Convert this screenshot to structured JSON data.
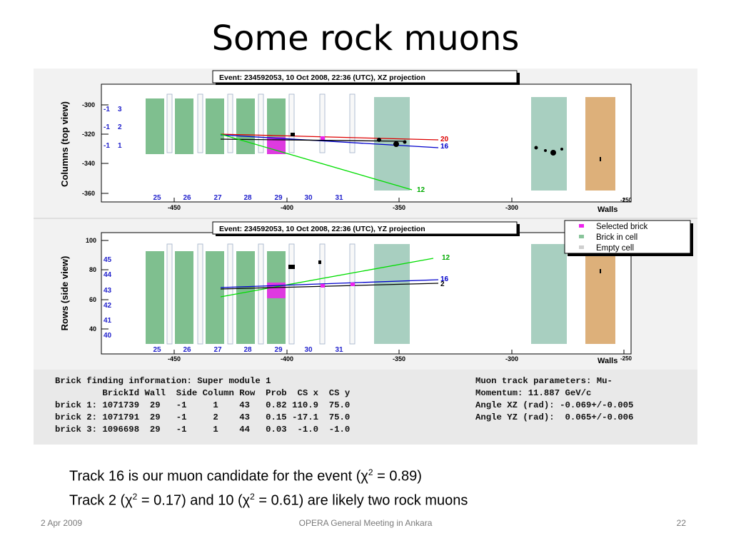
{
  "slide": {
    "title": "Some rock muons",
    "footer_left": "2 Apr 2009",
    "footer_center": "OPERA General Meeting in Ankara",
    "footer_right": "22"
  },
  "plot_top": {
    "header": "Event: 234592053, 10 Oct 2008, 22:36 (UTC), XZ projection",
    "ylabel": "Columns (top view)",
    "xlabel": "Walls",
    "x_ticks": [
      "-450",
      "-400",
      "-350",
      "-300",
      "-250"
    ],
    "y_ticks": [
      "-300",
      "-320",
      "-340",
      "-360"
    ],
    "walls": [
      "25",
      "26",
      "27",
      "28",
      "29",
      "30",
      "31"
    ],
    "left_labels": [
      [
        "-1",
        "3"
      ],
      [
        "-1",
        "2"
      ],
      [
        "-1",
        "1"
      ]
    ],
    "track_labels": [
      "20",
      "16",
      "12"
    ]
  },
  "plot_bottom": {
    "header": "Event: 234592053, 10 Oct 2008, 22:36 (UTC), YZ projection",
    "ylabel": "Rows (side view)",
    "xlabel": "Walls",
    "x_ticks": [
      "-450",
      "-400",
      "-350",
      "-300",
      "-250"
    ],
    "y_ticks": [
      "100",
      "80",
      "60",
      "40"
    ],
    "walls": [
      "25",
      "26",
      "27",
      "28",
      "29",
      "30",
      "31"
    ],
    "left_labels": [
      "45",
      "44",
      "43",
      "42",
      "41",
      "40"
    ],
    "track_labels": [
      "12",
      "16",
      "2"
    ],
    "legend": [
      {
        "label": "Selected brick",
        "color": "#ee22ee"
      },
      {
        "label": "Brick in cell",
        "color": "#88c49a"
      },
      {
        "label": "Empty cell",
        "color": "#cfcfcf"
      }
    ]
  },
  "colors": {
    "brick_green": "#7fbf8f",
    "tt_green": "#a8cfc0",
    "magnet_tan": "#ddb07a",
    "selected_magenta": "#ee22ee",
    "track_red": "#dd0000",
    "track_blue": "#0000cc",
    "track_green": "#00dd00",
    "track_black": "#000000"
  },
  "info_text": {
    "left": [
      "Brick finding information: Super module 1",
      "         BrickId Wall  Side Column Row  Prob  CS x  CS y",
      "brick 1: 1071739  29   -1     1    43   0.82 110.9  75.0",
      "brick 2: 1071791  29   -1     2    43   0.15 -17.1  75.0",
      "brick 3: 1096698  29   -1     1    44   0.03  -1.0  -1.0"
    ],
    "right": [
      "Muon track parameters: Mu-",
      "Momentum: 11.887 GeV/c",
      "Angle XZ (rad): -0.069+/-0.005",
      "Angle YZ (rad):  0.065+/-0.006"
    ]
  },
  "caption": {
    "line1_pre": "Track 16 is our muon candidate for the event (",
    "chi": "χ",
    "sup": "2",
    "line1_post": " = 0.89)",
    "line2_a": "Track 2 (",
    "line2_b": " = 0.17) and 10 (",
    "line2_c": " = 0.61) are likely two rock muons"
  }
}
